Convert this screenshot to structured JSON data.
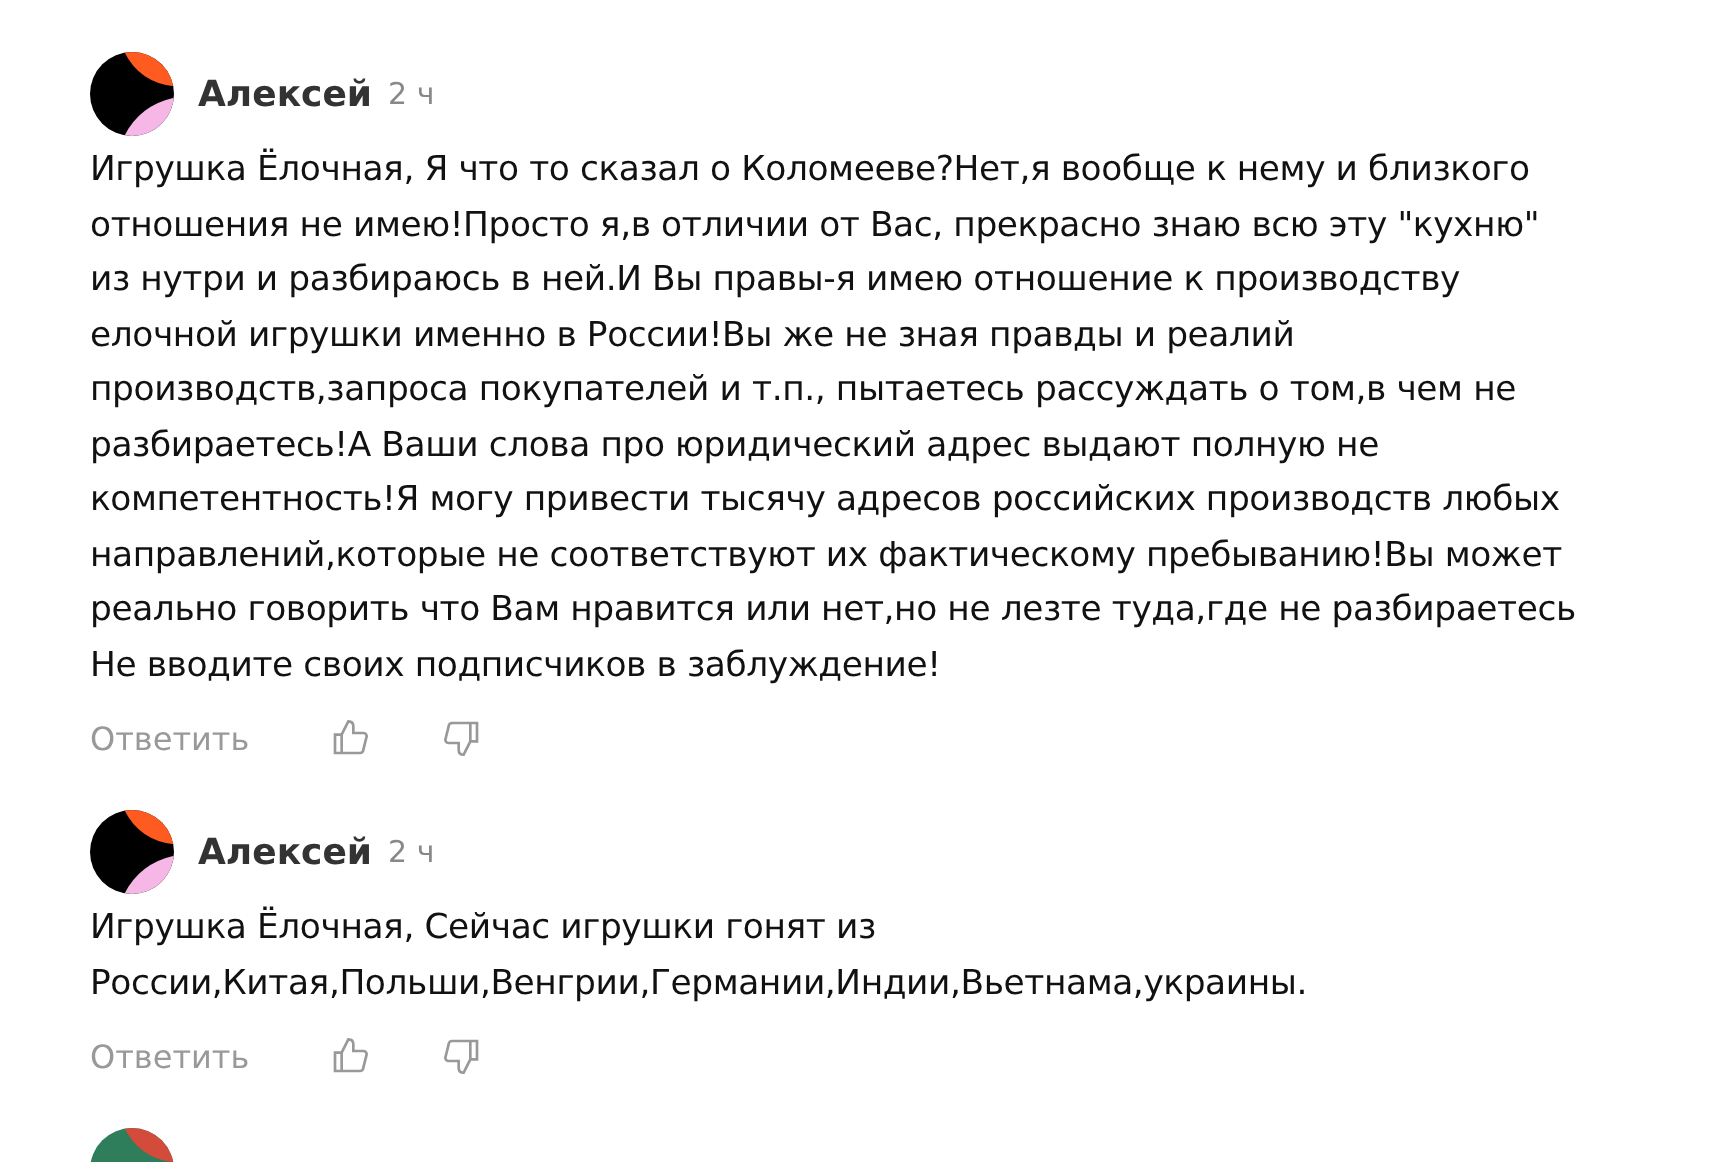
{
  "comments": [
    {
      "author": "Алексей",
      "time": "2 ч",
      "lines": [
        "Игрушка Ёлочная, Я что то сказал о Коломееве?Нет,я вообще к нему и близкого",
        "отношения не имею!Просто я,в отличии от Вас, прекрасно знаю всю эту \"кухню\"",
        "из нутри и разбираюсь в ней.И Вы правы-я имею отношение к производству",
        "елочной игрушки именно в России!Вы же не зная правды и реалий",
        "производств,запроса покупателей и т.п., пытаетесь рассуждать о том,в чем не",
        "разбираетесь!А Ваши слова про юридический адрес выдают полную не",
        "компетентность!Я могу привести тысячу адресов российских производств любых",
        "направлений,которые не соответствуют их фактическому пребыванию!Вы может",
        "реально говорить что Вам нравится или нет,но не лезте туда,где не разбираетесь",
        "Не вводите своих подписчиков в заблуждение!"
      ],
      "reply_label": "Ответить"
    },
    {
      "author": "Алексей",
      "time": "2 ч",
      "lines": [
        "Игрушка Ёлочная, Сейчас игрушки гонят из",
        "России,Китая,Польши,Венгрии,Германии,Индии,Вьетнама,украины."
      ],
      "reply_label": "Ответить"
    }
  ],
  "more_below": true
}
